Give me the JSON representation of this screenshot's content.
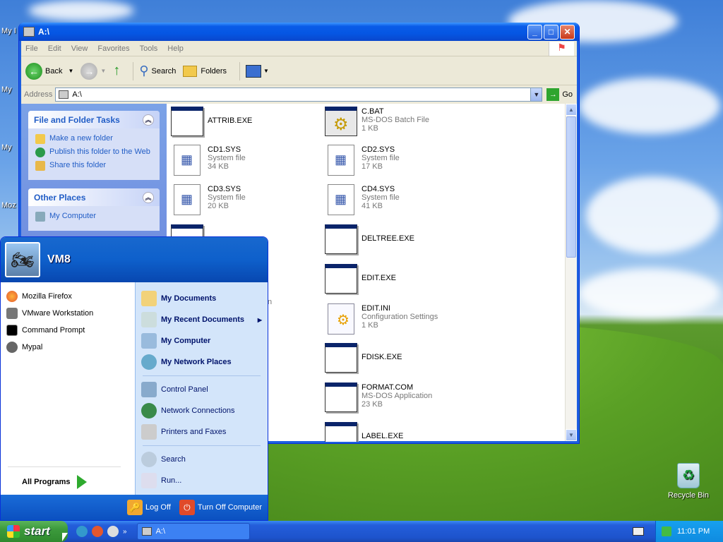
{
  "desktop": {
    "left_labels": [
      "My I",
      "My",
      "My",
      "Moz"
    ],
    "recycle_bin": "Recycle Bin"
  },
  "explorer": {
    "title": "A:\\",
    "menu": [
      "File",
      "Edit",
      "View",
      "Favorites",
      "Tools",
      "Help"
    ],
    "toolbar": {
      "back": "Back",
      "search": "Search",
      "folders": "Folders"
    },
    "address": {
      "label": "Address",
      "value": "A:\\",
      "go": "Go"
    },
    "tasks": {
      "title": "File and Folder Tasks",
      "items": [
        "Make a new folder",
        "Publish this folder to the Web",
        "Share this folder"
      ]
    },
    "other_places": {
      "title": "Other Places",
      "items": [
        "My Computer"
      ]
    },
    "files": [
      {
        "name": "ATTRIB.EXE",
        "type": "",
        "size": ""
      },
      {
        "name": "C.BAT",
        "type": "MS-DOS Batch File",
        "size": "1 KB"
      },
      {
        "name": "CD1.SYS",
        "type": "System file",
        "size": "34 KB"
      },
      {
        "name": "CD2.SYS",
        "type": "System file",
        "size": "17 KB"
      },
      {
        "name": "CD3.SYS",
        "type": "System file",
        "size": "20 KB"
      },
      {
        "name": "CD4.SYS",
        "type": "System file",
        "size": "41 KB"
      },
      {
        "name": "DELTREE.EXE",
        "type": "",
        "size": ""
      },
      {
        "name": "EDIT.EXE",
        "type": "",
        "size": ""
      },
      {
        "name": "EDIT.INI",
        "type": "Configuration Settings",
        "size": "1 KB"
      },
      {
        "name": "FDISK.EXE",
        "type": "",
        "size": ""
      },
      {
        "name": "FORMAT.COM",
        "type": "MS-DOS Application",
        "size": "23 KB"
      },
      {
        "name": "LABEL.EXE",
        "type": "",
        "size": ""
      }
    ],
    "partial_text": "n"
  },
  "start_menu": {
    "user": "VM8",
    "pinned": [
      "Mozilla Firefox",
      "VMware Workstation",
      "Command Prompt",
      "Mypal"
    ],
    "all_programs": "All Programs",
    "right": {
      "my_documents": "My Documents",
      "recent": "My Recent Documents",
      "my_computer": "My Computer",
      "network": "My Network Places",
      "control_panel": "Control Panel",
      "net_conn": "Network Connections",
      "printers": "Printers and Faxes",
      "search": "Search",
      "run": "Run..."
    },
    "log_off": "Log Off",
    "turn_off": "Turn Off Computer"
  },
  "taskbar": {
    "start": "start",
    "task": "A:\\",
    "clock": "11:01 PM"
  }
}
